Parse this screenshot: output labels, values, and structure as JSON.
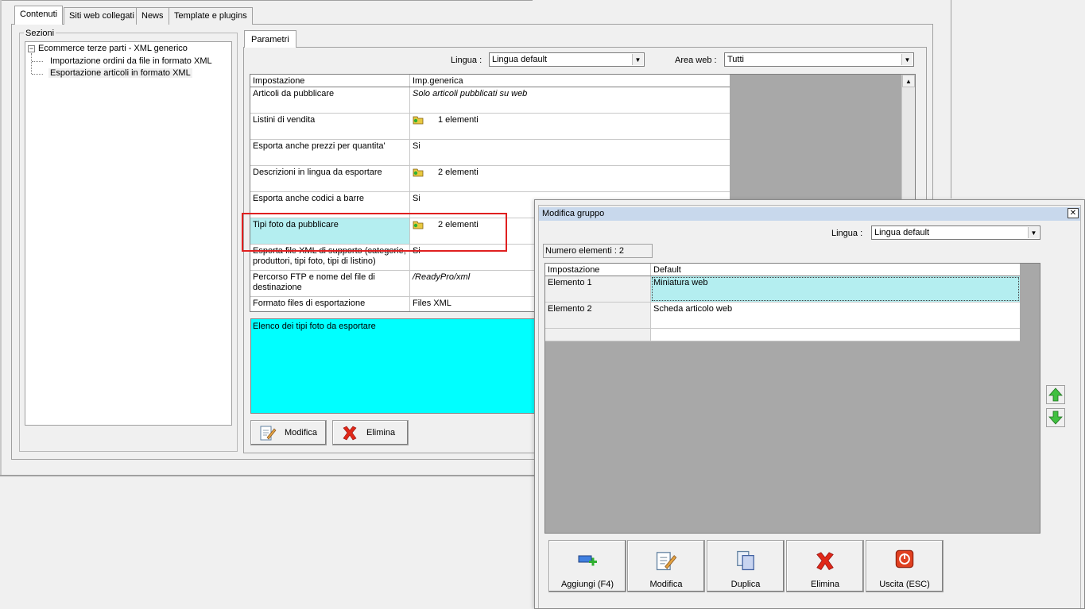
{
  "main_tabs": [
    "Contenuti",
    "Siti web collegati",
    "News",
    "Template e plugins"
  ],
  "sezioni": {
    "title": "Sezioni",
    "tree": {
      "root": "Ecommerce terze parti - XML generico",
      "children": [
        "Importazione ordini da file in formato XML",
        "Esportazione articoli in formato XML"
      ]
    }
  },
  "parametri": {
    "tab": "Parametri",
    "lingua_label": "Lingua :",
    "lingua_value": "Lingua default",
    "area_label": "Area web :",
    "area_value": "Tutti",
    "headers": [
      "Impostazione",
      "Imp.generica"
    ],
    "rows": [
      {
        "name": "Articoli da pubblicare",
        "value": "Solo articoli pubblicati su web"
      },
      {
        "name": "Listini di vendita",
        "value": "1 elementi"
      },
      {
        "name": "Esporta anche prezzi per quantita'",
        "value": "Si"
      },
      {
        "name": "Descrizioni in lingua da esportare",
        "value": "2 elementi"
      },
      {
        "name": "Esporta anche codici a barre",
        "value": "Si"
      },
      {
        "name": "Tipi foto da pubblicare",
        "value": "2 elementi"
      },
      {
        "name": "Esporta file XML di supporto (categorie, produttori, tipi foto, tipi di listino)",
        "value": "Si"
      },
      {
        "name": "Percorso FTP e nome del file di destinazione",
        "value": "/ReadyPro/xml"
      },
      {
        "name": "Formato files di esportazione",
        "value": "Files XML"
      }
    ],
    "description": "Elenco dei tipi foto da esportare",
    "buttons": {
      "modifica": "Modifica",
      "elimina": "Elimina"
    }
  },
  "dialog": {
    "title": "Modifica gruppo",
    "close": "✕",
    "lingua_label": "Lingua :",
    "lingua_value": "Lingua default",
    "count": "Numero elementi : 2",
    "headers": [
      "Impostazione",
      "Default"
    ],
    "rows": [
      {
        "name": "Elemento 1",
        "value": "Miniatura web"
      },
      {
        "name": "Elemento 2",
        "value": "Scheda articolo web"
      }
    ],
    "buttons": {
      "aggiungi": "Aggiungi (F4)",
      "modifica": "Modifica",
      "duplica": "Duplica",
      "elimina": "Elimina",
      "uscita": "Uscita (ESC)"
    }
  },
  "colors": {
    "selection": "#b4eef0",
    "description_bg": "#00ffff",
    "highlight": "#e02020"
  }
}
